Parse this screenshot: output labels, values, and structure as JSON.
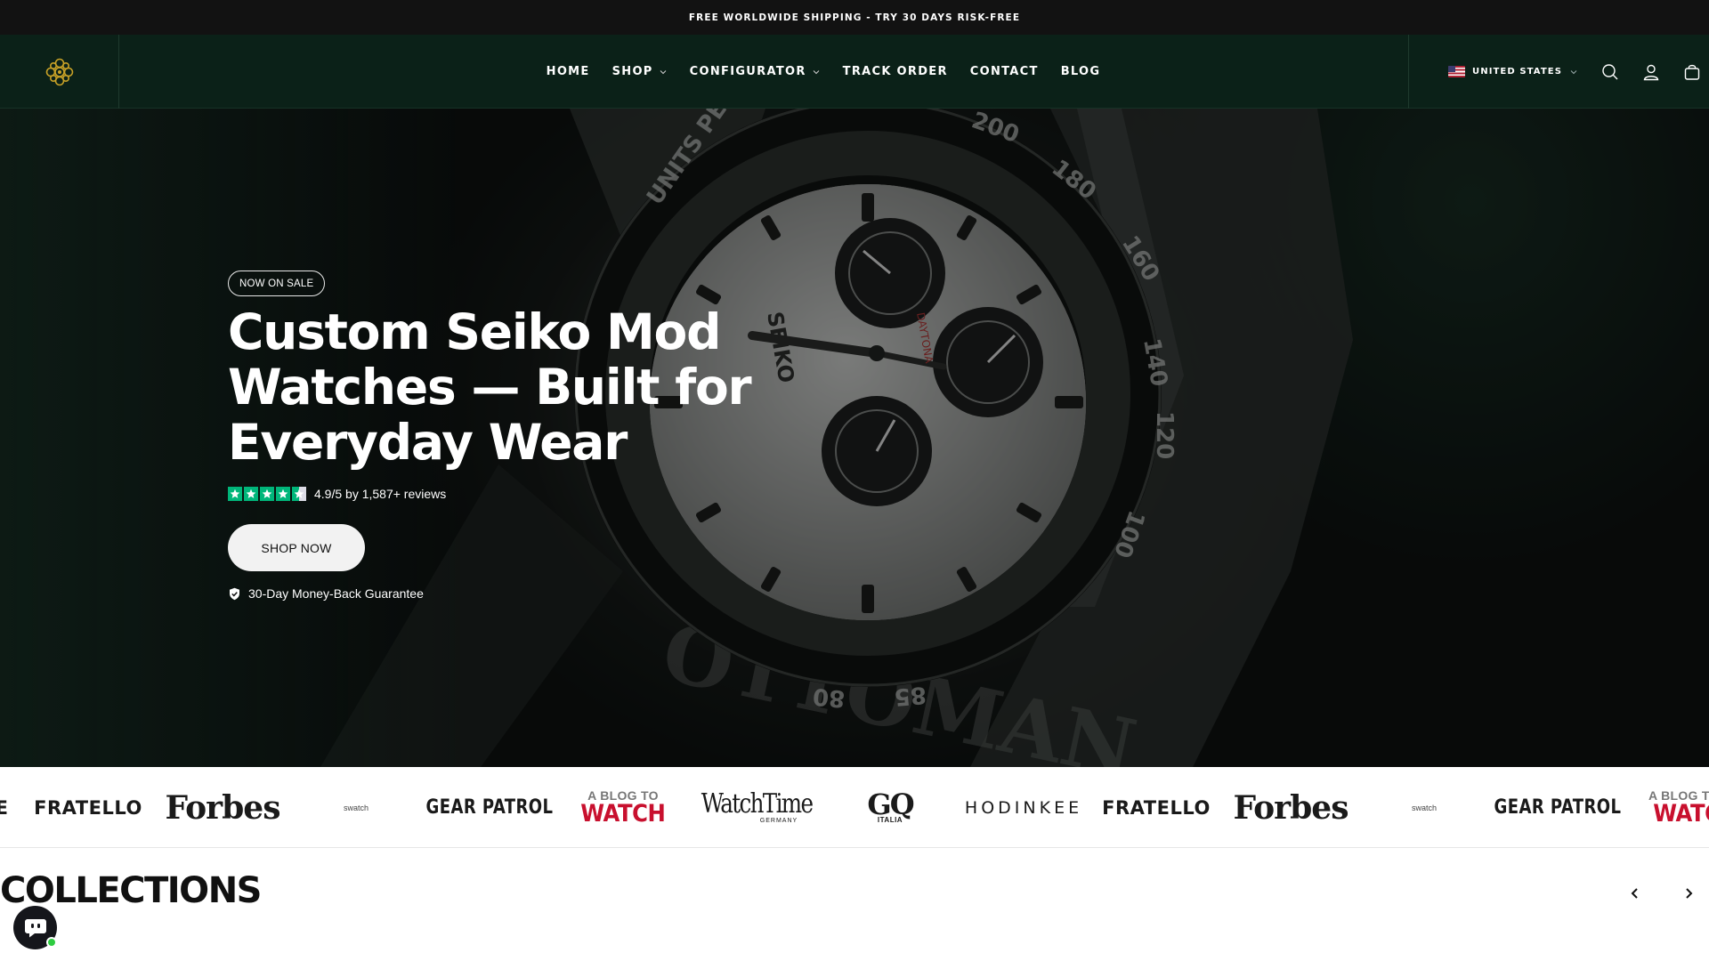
{
  "announcement": "FREE WORLDWIDE SHIPPING - TRY 30 DAYS RISK-FREE",
  "nav": {
    "home": "HOME",
    "shop": "SHOP",
    "configurator": "CONFIGURATOR",
    "track_order": "TRACK ORDER",
    "contact": "CONTACT",
    "blog": "BLOG"
  },
  "country": "UNITED STATES",
  "hero": {
    "badge": "NOW ON SALE",
    "title": "Custom Seiko Mod Watches — Built for Everyday Wear",
    "rating_text": "4.9/5 by 1,587+ reviews",
    "rating_value": 4.5,
    "cta": "SHOP NOW",
    "guarantee": "30-Day Money-Back Guarantee"
  },
  "press": {
    "logos": [
      "FRATELLO",
      "Forbes",
      "swatch",
      "GEAR PATROL",
      "A BLOG TO",
      "WATCH",
      "WatchTime",
      "GERMANY",
      "GQ",
      "ITALIA",
      "HODINKEE"
    ]
  },
  "collections": {
    "title": "COLLECTIONS"
  },
  "colors": {
    "header_bg": "#0b2118",
    "announce_bg": "#121212",
    "star_green": "#00b67a"
  }
}
